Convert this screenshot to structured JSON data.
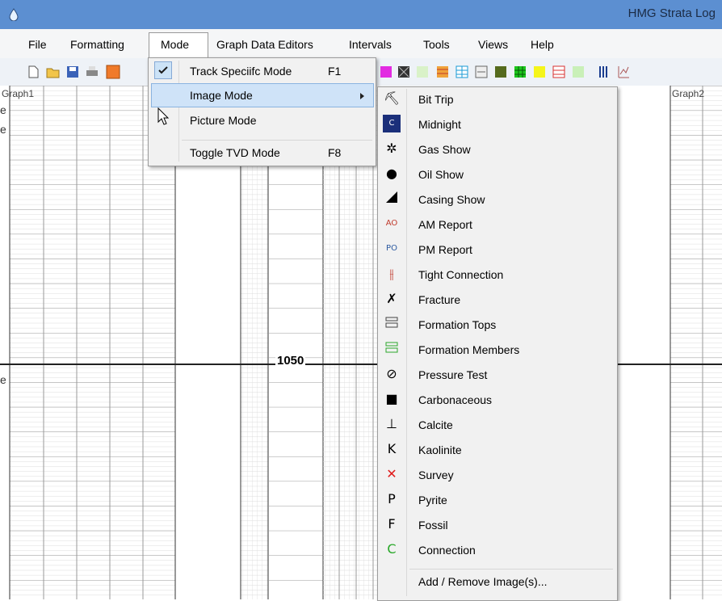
{
  "window": {
    "title": "HMG Strata Log"
  },
  "menubar": {
    "items": [
      "File",
      "Formatting",
      "Mode",
      "Graph Data Editors",
      "Intervals",
      "Tools",
      "Views",
      "Help"
    ]
  },
  "graph": {
    "left_label": "Graph1",
    "right_label": "Graph2",
    "depth_label": "1050"
  },
  "mode_menu": {
    "items": [
      {
        "label": "Track Speciifc Mode",
        "shortcut": "F1",
        "checked": true
      },
      {
        "label": "Image Mode",
        "has_submenu": true,
        "highlighted": true
      },
      {
        "label": "Picture Mode"
      },
      {
        "label": "Toggle TVD Mode",
        "shortcut": "F8"
      }
    ]
  },
  "image_menu": {
    "items": [
      {
        "label": "Bit Trip",
        "icon": "bit-trip-icon"
      },
      {
        "label": "Midnight",
        "icon": "midnight-icon"
      },
      {
        "label": "Gas Show",
        "icon": "gas-show-icon"
      },
      {
        "label": "Oil Show",
        "icon": "oil-show-icon"
      },
      {
        "label": "Casing Show",
        "icon": "casing-show-icon"
      },
      {
        "label": "AM Report",
        "icon": "am-report-icon"
      },
      {
        "label": "PM Report",
        "icon": "pm-report-icon"
      },
      {
        "label": "Tight Connection",
        "icon": "tight-connection-icon"
      },
      {
        "label": "Fracture",
        "icon": "fracture-icon"
      },
      {
        "label": "Formation Tops",
        "icon": "formation-tops-icon"
      },
      {
        "label": "Formation Members",
        "icon": "formation-members-icon"
      },
      {
        "label": "Pressure Test",
        "icon": "pressure-test-icon"
      },
      {
        "label": "Carbonaceous",
        "icon": "carbonaceous-icon"
      },
      {
        "label": "Calcite",
        "icon": "calcite-icon"
      },
      {
        "label": "Kaolinite",
        "icon": "kaolinite-icon"
      },
      {
        "label": "Survey",
        "icon": "survey-icon"
      },
      {
        "label": "Pyrite",
        "icon": "pyrite-icon"
      },
      {
        "label": "Fossil",
        "icon": "fossil-icon"
      },
      {
        "label": "Connection",
        "icon": "connection-icon"
      }
    ],
    "footer": "Add / Remove Image(s)..."
  },
  "icon_glyphs": {
    "bit-trip": "⛏",
    "gas-show": "✲",
    "oil-show": "●",
    "tight-connection": "⫲",
    "fracture": "✗",
    "pressure-test": "⊘",
    "carbonaceous": "■",
    "calcite": "⊥",
    "kaolinite": "K",
    "survey": "✕",
    "pyrite": "P",
    "fossil": "F",
    "connection": "C"
  },
  "icon_glyph_text": {
    "am-report": "AO",
    "pm-report": "PO",
    "midnight": "C"
  },
  "colors": {
    "titlebar": "#5c8fd1",
    "highlight": "#cfe3f8",
    "survey": "#e01b1b",
    "connection": "#2aa82a",
    "midnight_bg": "#1b2f7a"
  }
}
